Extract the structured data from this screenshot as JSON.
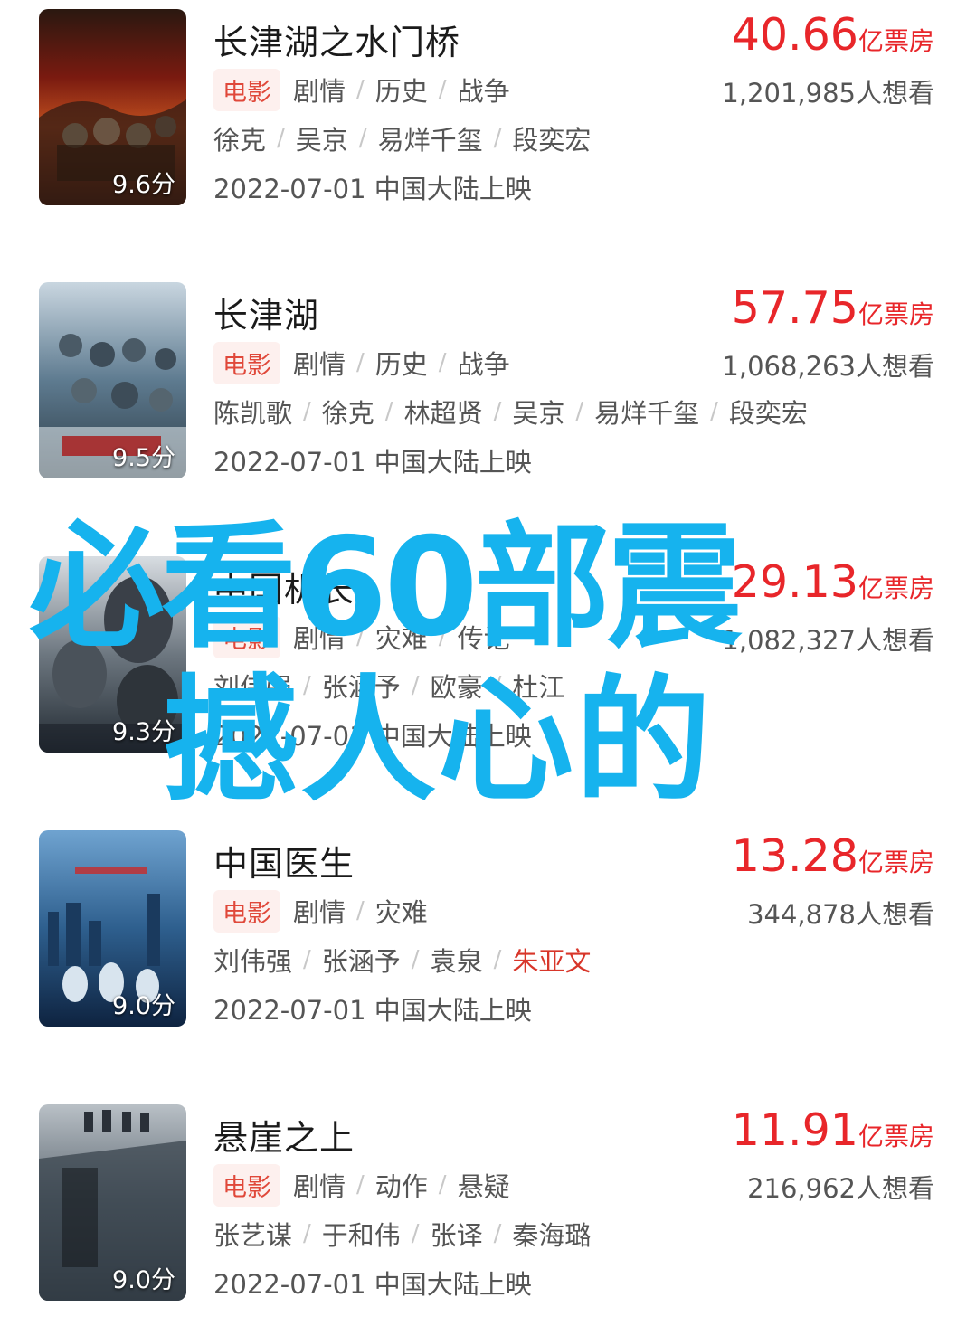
{
  "movies": [
    {
      "title": "长津湖之水门桥",
      "rating": "9.6分",
      "box_office": "40.66",
      "box_unit": "亿票房",
      "want": "1,201,985人想看",
      "type_badge": "电影",
      "genres": [
        "剧情",
        "历史",
        "战争"
      ],
      "cast": [
        "徐克",
        "吴京",
        "易烊千玺",
        "段奕宏"
      ],
      "release": "2022-07-01 中国大陆上映",
      "poster_colors": [
        "#7a1a10",
        "#c0501f",
        "#2a1810"
      ]
    },
    {
      "title": "长津湖",
      "rating": "9.5分",
      "box_office": "57.75",
      "box_unit": "亿票房",
      "want": "1,068,263人想看",
      "type_badge": "电影",
      "genres": [
        "剧情",
        "历史",
        "战争"
      ],
      "cast": [
        "陈凯歌",
        "徐克",
        "林超贤",
        "吴京",
        "易烊千玺",
        "段奕宏"
      ],
      "release": "2022-07-01 中国大陆上映",
      "poster_colors": [
        "#c9d6e0",
        "#5e7b90",
        "#2c3a44"
      ]
    },
    {
      "title": "中国机长",
      "rating": "9.3分",
      "box_office": "29.13",
      "box_unit": "亿票房",
      "want": "1,082,327人想看",
      "type_badge": "电影",
      "genres": [
        "剧情",
        "灾难",
        "传记"
      ],
      "cast": [
        "刘伟强",
        "张涵予",
        "欧豪",
        "杜江"
      ],
      "release": "2022-07-01 中国大陆上映",
      "poster_colors": [
        "#d8dde2",
        "#6d7780",
        "#222a32"
      ]
    },
    {
      "title": "中国医生",
      "rating": "9.0分",
      "box_office": "13.28",
      "box_unit": "亿票房",
      "want": "344,878人想看",
      "type_badge": "电影",
      "genres": [
        "剧情",
        "灾难"
      ],
      "cast": [
        "刘伟强",
        "张涵予",
        "袁泉",
        "朱亚文"
      ],
      "release": "2022-07-01 中国大陆上映",
      "poster_colors": [
        "#6fa3d0",
        "#2e5f8e",
        "#0e2340"
      ]
    },
    {
      "title": "悬崖之上",
      "rating": "9.0分",
      "box_office": "11.91",
      "box_unit": "亿票房",
      "want": "216,962人想看",
      "type_badge": "电影",
      "genres": [
        "剧情",
        "动作",
        "悬疑"
      ],
      "cast": [
        "张艺谋",
        "于和伟",
        "张译",
        "秦海璐"
      ],
      "release": "2022-07-01 中国大陆上映",
      "poster_colors": [
        "#b9c0c6",
        "#5b6670",
        "#1e252c"
      ]
    }
  ],
  "overlay": {
    "line1": "必看60部震",
    "line2": "撼人心的",
    "color": "#16b3ee"
  }
}
